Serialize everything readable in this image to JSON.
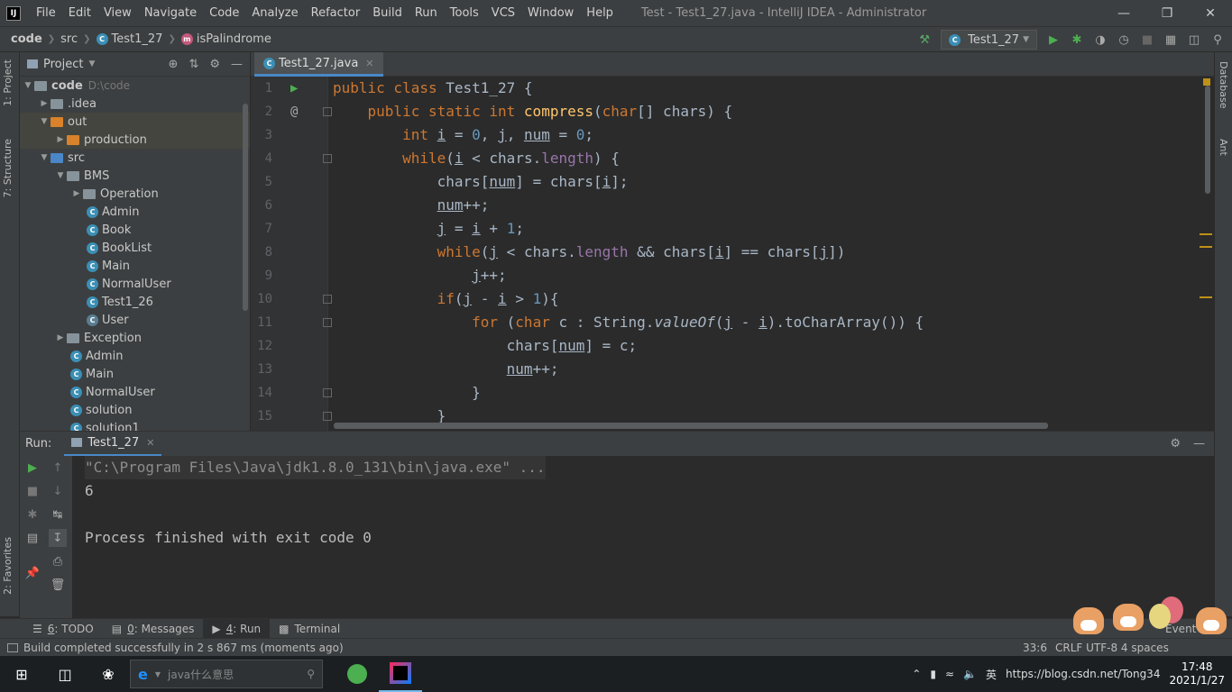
{
  "titlebar": {
    "logo": "IJ",
    "menu": [
      "File",
      "Edit",
      "View",
      "Navigate",
      "Code",
      "Analyze",
      "Refactor",
      "Build",
      "Run",
      "Tools",
      "VCS",
      "Window",
      "Help"
    ],
    "window_title": "Test - Test1_27.java - IntelliJ IDEA - Administrator"
  },
  "navbar": {
    "crumbs": [
      "code",
      "src",
      "Test1_27",
      "isPalindrome"
    ],
    "run_config": "Test1_27"
  },
  "left_stripe": {
    "project_tab": "1: Project",
    "structure_tab": "7: Structure",
    "favorites_tab": "2: Favorites"
  },
  "right_stripe": {
    "database_tab": "Database",
    "ant_tab": "Ant"
  },
  "project": {
    "title": "Project",
    "root": "code",
    "root_path": "D:\\code",
    "items": [
      {
        "label": ".idea"
      },
      {
        "label": "out"
      },
      {
        "label": "production"
      },
      {
        "label": "src"
      },
      {
        "label": "BMS"
      },
      {
        "label": "Operation"
      },
      {
        "label": "Admin"
      },
      {
        "label": "Book"
      },
      {
        "label": "BookList"
      },
      {
        "label": "Main"
      },
      {
        "label": "NormalUser"
      },
      {
        "label": "Test1_26"
      },
      {
        "label": "User"
      },
      {
        "label": "Exception"
      },
      {
        "label": "Admin"
      },
      {
        "label": "Main"
      },
      {
        "label": "NormalUser"
      },
      {
        "label": "solution"
      },
      {
        "label": "solution1"
      }
    ]
  },
  "editor": {
    "tab": "Test1_27.java",
    "line_numbers": [
      "1",
      "2",
      "3",
      "4",
      "5",
      "6",
      "7",
      "8",
      "9",
      "10",
      "11",
      "12",
      "13",
      "14",
      "15"
    ],
    "lines": [
      "public class Test1_27 {",
      "    public static int compress(char[] chars) {",
      "        int i = 0, j, num = 0;",
      "        while(i < chars.length) {",
      "            chars[num] = chars[i];",
      "            num++;",
      "            j = i + 1;",
      "            while(j < chars.length && chars[i] == chars[j])",
      "                j++;",
      "            if(j - i > 1){",
      "                for (char c : String.valueOf(j - i).toCharArray()) {",
      "                    chars[num] = c;",
      "                    num++;",
      "                }",
      "            }"
    ]
  },
  "run": {
    "label": "Run:",
    "tab": "Test1_27",
    "console": [
      "\"C:\\Program Files\\Java\\jdk1.8.0_131\\bin\\java.exe\" ...",
      "6",
      "",
      "Process finished with exit code 0"
    ]
  },
  "bottom_tabs": {
    "todo_num": "6",
    "todo": ": TODO",
    "messages_num": "0",
    "messages": ": Messages",
    "run_num": "4",
    "run": ": Run",
    "terminal": "Terminal",
    "event_log": "Event Lo"
  },
  "status": {
    "message": "Build completed successfully in 2 s 867 ms (moments ago)",
    "position": "33:6",
    "encoding": "CRLF  UTF-8  4 spaces"
  },
  "taskbar": {
    "search_placeholder": "java什么意思",
    "time": "17:48",
    "date": "2021/1/27",
    "ime": "英",
    "watermark": "https://blog.csdn.net/Tong34"
  }
}
